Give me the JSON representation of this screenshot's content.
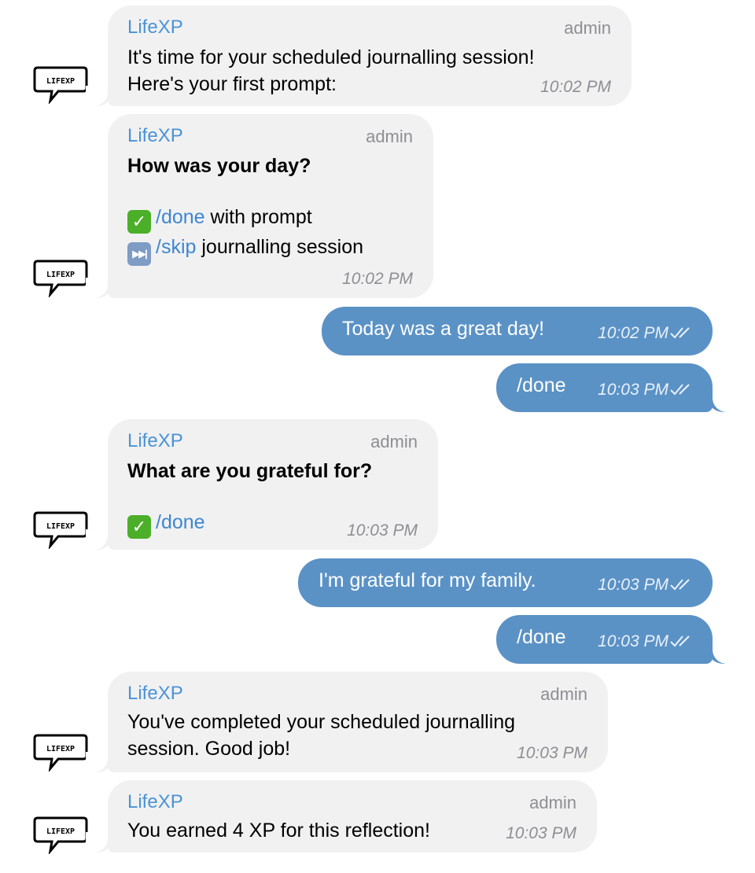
{
  "chat": {
    "bot_name": "LifeXP",
    "role": "admin",
    "avatar_text": "LIFEXP",
    "m1": {
      "line1": "It's time for your scheduled journalling session!",
      "line2": "Here's your first prompt:",
      "time": "10:02 PM"
    },
    "m2": {
      "question": "How was your day?",
      "done_cmd": "/done",
      "done_text": "with prompt",
      "skip_cmd": "/skip",
      "skip_text": "journalling session",
      "time": "10:02 PM"
    },
    "u1": {
      "text": "Today was a great day!",
      "time": "10:02 PM"
    },
    "u2": {
      "text": "/done",
      "time": "10:03 PM"
    },
    "m3": {
      "question": "What are you grateful for?",
      "done_cmd": "/done",
      "time": "10:03 PM"
    },
    "u3": {
      "text": "I'm grateful for my family.",
      "time": "10:03 PM"
    },
    "u4": {
      "text": "/done",
      "time": "10:03 PM"
    },
    "m4": {
      "line1": "You've completed your scheduled journalling",
      "line2": "session. Good job!",
      "time": "10:03 PM"
    },
    "m5": {
      "line1": "You earned 4 XP for this reflection!",
      "time": "10:03 PM"
    }
  },
  "colors": {
    "incoming_bubble": "#f1f1f2",
    "outgoing_bubble": "#5b92c6",
    "link": "#3e86cf",
    "sender_name": "#4a93d6"
  },
  "icons": {
    "avatar": "lifexp-speech-bubble-logo",
    "read_receipt": "double-check-icon",
    "done_emoji": "check-mark-button-icon",
    "skip_emoji": "next-track-button-icon"
  }
}
